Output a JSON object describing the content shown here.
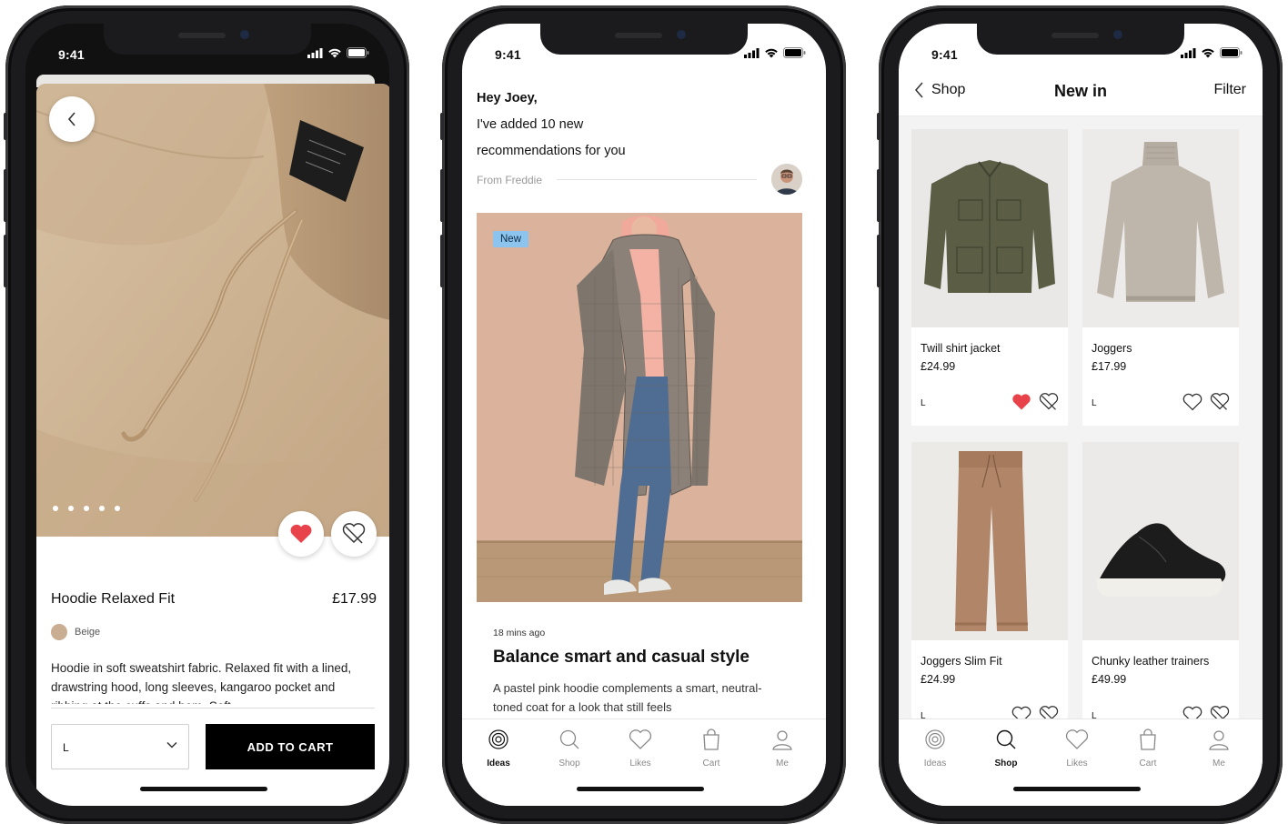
{
  "status": {
    "time": "9:41"
  },
  "product": {
    "title": "Hoodie Relaxed Fit",
    "price": "£17.99",
    "color": "Beige",
    "description": "Hoodie in soft sweatshirt fabric. Relaxed fit with a lined, drawstring hood, long sleeves, kangaroo pocket and ribbing at the cuffs and hem. Soft",
    "size": "L",
    "add_to_cart": "ADD TO CART",
    "image_count": 5,
    "current_image": 1,
    "liked": true
  },
  "ideas": {
    "greeting": "Hey Joey,",
    "message_line1": "I've added 10 new",
    "message_line2": "recommendations for you",
    "from": "From Freddie",
    "badge": "New",
    "time_ago": "18 mins ago",
    "article_title": "Balance smart and casual style",
    "article_text": "A pastel pink hoodie complements a smart, neutral-toned coat for a look that still feels"
  },
  "tabs": [
    {
      "label": "Ideas",
      "icon": "ideas-icon"
    },
    {
      "label": "Shop",
      "icon": "search-icon"
    },
    {
      "label": "Likes",
      "icon": "heart-icon"
    },
    {
      "label": "Cart",
      "icon": "bag-icon"
    },
    {
      "label": "Me",
      "icon": "user-icon"
    }
  ],
  "shop": {
    "back_label": "Shop",
    "title": "New in",
    "filter": "Filter",
    "products": [
      {
        "name": "Twill shirt jacket",
        "price": "£24.99",
        "size": "L",
        "liked": true
      },
      {
        "name": "Joggers",
        "price": "£17.99",
        "size": "L",
        "liked": false
      },
      {
        "name": "Joggers Slim Fit",
        "price": "£24.99",
        "size": "L",
        "liked": false
      },
      {
        "name": "Chunky leather trainers",
        "price": "£49.99",
        "size": "L",
        "liked": false
      }
    ]
  },
  "colors": {
    "accent_red": "#e8434b",
    "badge_blue": "#8cc4ee",
    "black": "#000000"
  }
}
